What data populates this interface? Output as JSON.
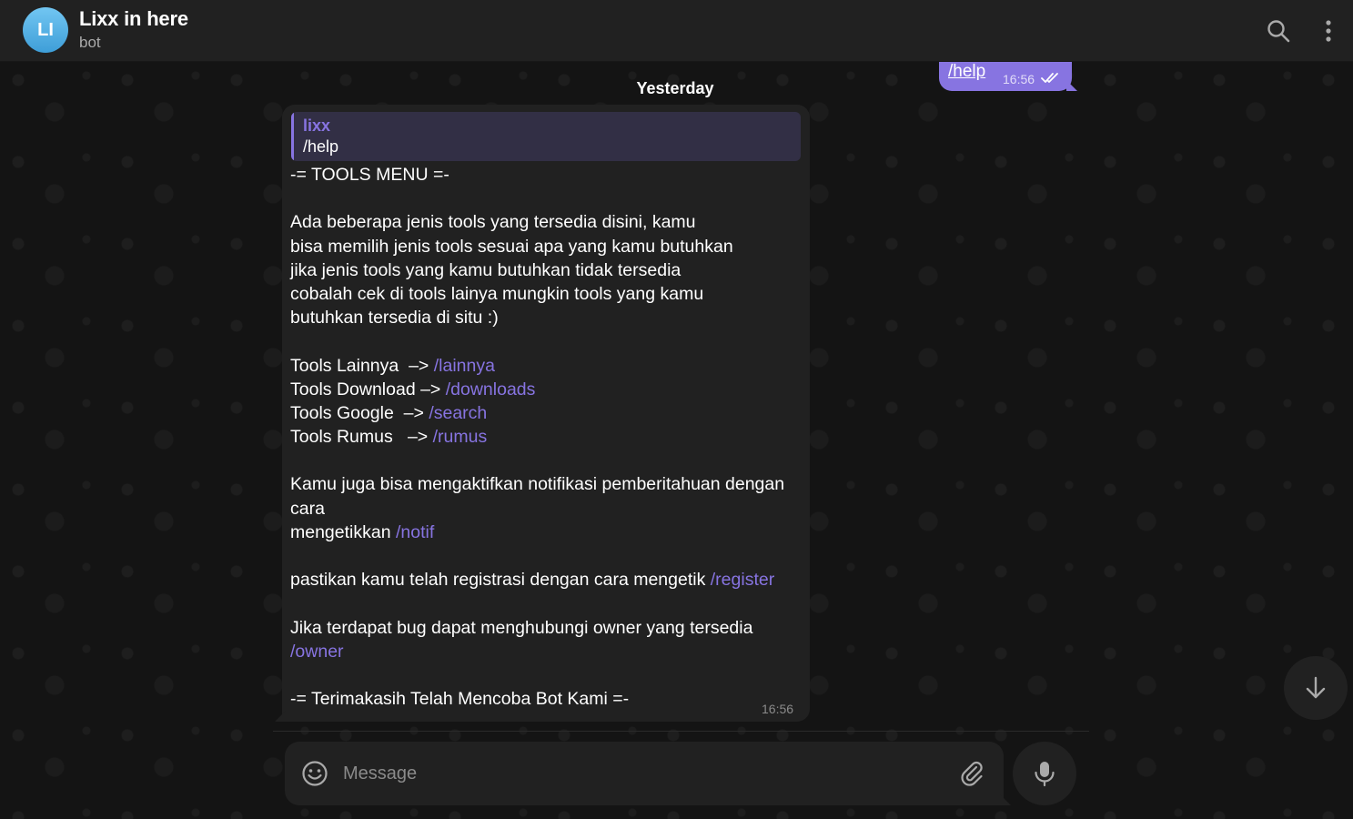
{
  "header": {
    "avatar_initials": "LI",
    "title": "Lixx in here",
    "status": "bot",
    "avatar_color": "#4aa3df"
  },
  "date_chip": "Yesterday",
  "outgoing": {
    "text": "/help",
    "time": "16:56",
    "status": "read"
  },
  "incoming": {
    "reply": {
      "name": "lixx",
      "text": "/help"
    },
    "lines": [
      "-= TOOLS MENU =-",
      "",
      "Ada beberapa jenis tools yang tersedia disini, kamu",
      "bisa memilih jenis tools sesuai apa yang kamu butuhkan",
      "jika jenis tools yang kamu butuhkan tidak tersedia",
      "cobalah cek di tools lainya mungkin tools yang kamu",
      "butuhkan tersedia di situ :)",
      ""
    ],
    "tools": [
      {
        "label": "Tools Lainnya  –> ",
        "cmd": "/lainnya"
      },
      {
        "label": "Tools Download –> ",
        "cmd": "/downloads"
      },
      {
        "label": "Tools Google  –> ",
        "cmd": "/search"
      },
      {
        "label": "Tools Rumus   –> ",
        "cmd": "/rumus"
      }
    ],
    "notif_text": "Kamu juga bisa mengaktifkan notifikasi pemberitahuan dengan cara",
    "notif_prefix": "mengetikkan ",
    "notif_cmd": "/notif",
    "register_text": "pastikan kamu telah registrasi dengan cara mengetik ",
    "register_cmd": "/register",
    "owner_text": "Jika terdapat bug dapat menghubungi owner yang tersedia",
    "owner_cmd": "/owner",
    "footer": "-= Terimakasih Telah Mencoba Bot Kami =-",
    "time": "16:56"
  },
  "composer": {
    "placeholder": "Message"
  },
  "colors": {
    "accent": "#8774e1",
    "bubble": "#212121",
    "header": "#212121"
  },
  "icons": {
    "search": "search-icon",
    "more": "more-vertical-icon",
    "emoji": "emoji-icon",
    "attach": "paperclip-icon",
    "mic": "microphone-icon",
    "scroll": "arrow-down-icon",
    "read": "double-check-icon"
  }
}
